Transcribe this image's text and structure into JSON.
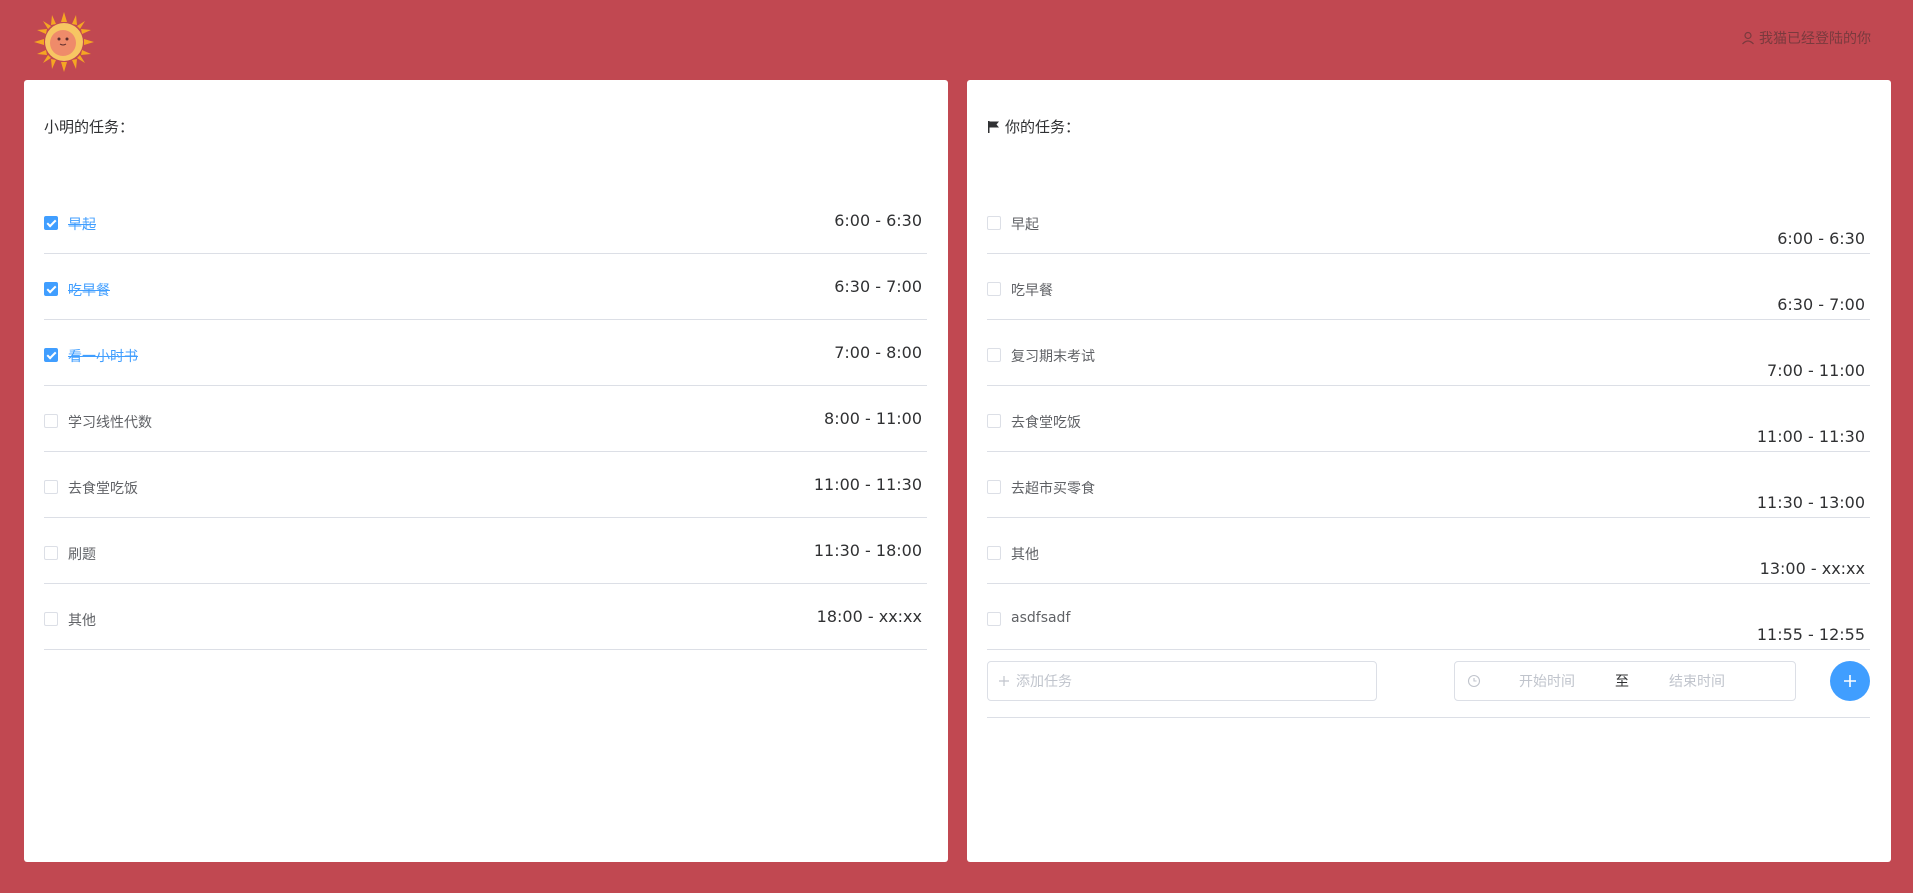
{
  "header": {
    "status_text": "我猫已经登陆的你"
  },
  "left_panel": {
    "title": "小明的任务：",
    "tasks": [
      {
        "name": "早起",
        "time": "6:00 - 6:30",
        "done": true
      },
      {
        "name": "吃早餐",
        "time": "6:30 - 7:00",
        "done": true
      },
      {
        "name": "看一小时书",
        "time": "7:00 - 8:00",
        "done": true
      },
      {
        "name": "学习线性代数",
        "time": "8:00 - 11:00",
        "done": false
      },
      {
        "name": "去食堂吃饭",
        "time": "11:00 - 11:30",
        "done": false
      },
      {
        "name": "刷题",
        "time": "11:30 - 18:00",
        "done": false
      },
      {
        "name": "其他",
        "time": "18:00 - xx:xx",
        "done": false
      }
    ]
  },
  "right_panel": {
    "title": "你的任务：",
    "tasks": [
      {
        "name": "早起",
        "time": "6:00 - 6:30",
        "done": false
      },
      {
        "name": "吃早餐",
        "time": "6:30 - 7:00",
        "done": false
      },
      {
        "name": "复习期末考试",
        "time": "7:00 - 11:00",
        "done": false
      },
      {
        "name": "去食堂吃饭",
        "time": "11:00 - 11:30",
        "done": false
      },
      {
        "name": "去超市买零食",
        "time": "11:30 - 13:00",
        "done": false
      },
      {
        "name": "其他",
        "time": "13:00 - xx:xx",
        "done": false
      },
      {
        "name": "asdfsadf",
        "time": "11:55 - 12:55",
        "done": false
      }
    ],
    "add_task": {
      "placeholder": "添加任务",
      "start_placeholder": "开始时间",
      "separator": "至",
      "end_placeholder": "结束时间"
    }
  },
  "colors": {
    "background": "#c14851",
    "accent": "#409eff"
  }
}
